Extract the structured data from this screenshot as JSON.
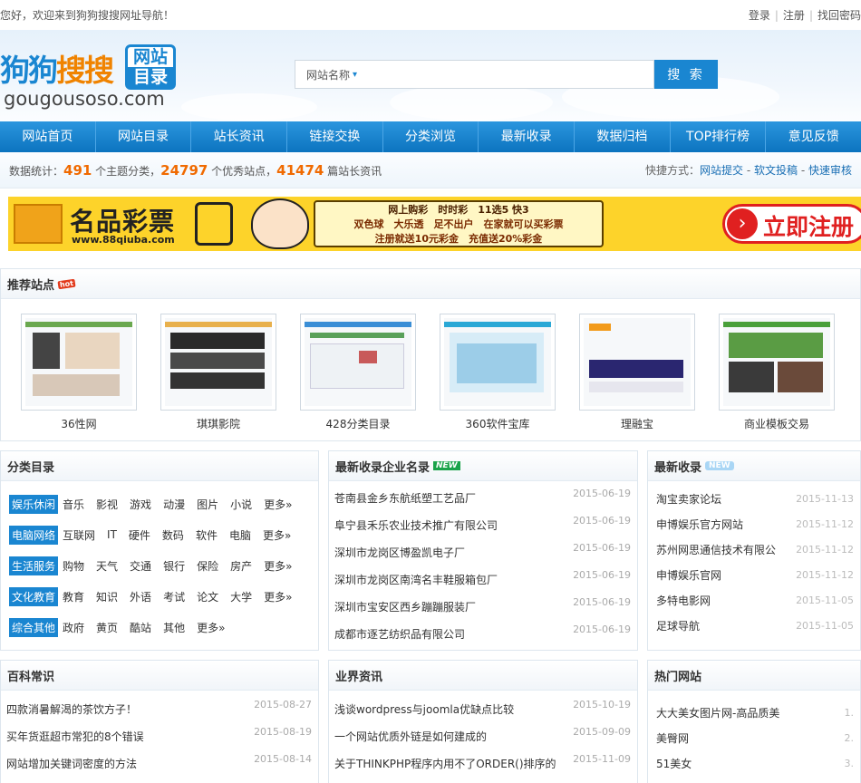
{
  "topbar": {
    "welcome": "您好，欢迎来到狗狗搜搜网址导航！",
    "login": "登录",
    "register": "注册",
    "forgot": "找回密码"
  },
  "logo": {
    "main_a": "狗狗",
    "main_b": "搜搜",
    "box_l1": "网站",
    "box_l2": "目录",
    "domain": "gougousoso.com"
  },
  "search": {
    "select_label": "网站名称",
    "placeholder": "",
    "button": "搜 索"
  },
  "nav": [
    "网站首页",
    "网站目录",
    "站长资讯",
    "链接交换",
    "分类浏览",
    "最新收录",
    "数据归档",
    "TOP排行榜",
    "意见反馈"
  ],
  "stats": {
    "prefix": "数据统计：",
    "cat_count": "491",
    "cat_label": " 个主题分类，",
    "site_count": "24797",
    "site_label": " 个优秀站点，",
    "article_count": "41474",
    "article_label": " 篇站长资讯",
    "quick_label": "快捷方式：",
    "quick_links": [
      "网站提交",
      "软文投稿",
      "快速审核"
    ]
  },
  "banner": {
    "title": "名品彩票",
    "url": "www.88qiuba.com",
    "line1": "网上购彩　时时彩　11选5 快3",
    "line2": "双色球　大乐透　足不出户　在家就可以买彩票",
    "line3": "注册就送10元彩金　充值送20%彩金",
    "register": "立即注册"
  },
  "recommend": {
    "title": "推荐站点",
    "hot": "hot",
    "sites": [
      "36性网",
      "琪琪影院",
      "428分类目录",
      "360软件宝库",
      "理融宝",
      "商业模板交易"
    ]
  },
  "categories": {
    "title": "分类目录",
    "more": "更多»",
    "rows": [
      {
        "tag": "娱乐休闲",
        "links": [
          "音乐",
          "影视",
          "游戏",
          "动漫",
          "图片",
          "小说"
        ]
      },
      {
        "tag": "电脑网络",
        "links": [
          "互联网",
          "IT",
          "硬件",
          "数码",
          "软件",
          "电脑"
        ]
      },
      {
        "tag": "生活服务",
        "links": [
          "购物",
          "天气",
          "交通",
          "银行",
          "保险",
          "房产"
        ]
      },
      {
        "tag": "文化教育",
        "links": [
          "教育",
          "知识",
          "外语",
          "考试",
          "论文",
          "大学"
        ]
      },
      {
        "tag": "综合其他",
        "links": [
          "政府",
          "黄页",
          "酷站",
          "其他"
        ]
      }
    ]
  },
  "companies": {
    "title": "最新收录企业名录",
    "new": "NEW",
    "items": [
      {
        "title": "苍南县金乡东航纸塑工艺品厂",
        "date": "2015-06-19"
      },
      {
        "title": "阜宁县禾乐农业技术推广有限公司",
        "date": "2015-06-19"
      },
      {
        "title": "深圳市龙岗区博盈凯电子厂",
        "date": "2015-06-19"
      },
      {
        "title": "深圳市龙岗区南湾名丰鞋服箱包厂",
        "date": "2015-06-19"
      },
      {
        "title": "深圳市宝安区西乡蹦蹦服装厂",
        "date": "2015-06-19"
      },
      {
        "title": "成都市逐艺纺织品有限公司",
        "date": "2015-06-19"
      }
    ]
  },
  "latest": {
    "title": "最新收录",
    "new": "NEW",
    "items": [
      {
        "title": "淘宝卖家论坛",
        "date": "2015-11-13"
      },
      {
        "title": "申博娱乐官方网站",
        "date": "2015-11-12"
      },
      {
        "title": "苏州网思通信技术有限公",
        "date": "2015-11-12"
      },
      {
        "title": "申博娱乐官网",
        "date": "2015-11-12"
      },
      {
        "title": "多特电影网",
        "date": "2015-11-05"
      },
      {
        "title": "足球导航",
        "date": "2015-11-05"
      }
    ]
  },
  "wiki": {
    "title": "百科常识",
    "items": [
      {
        "title": "四款消暑解渴的茶饮方子！",
        "date": "2015-08-27"
      },
      {
        "title": "买年货逛超市常犯的8个错误",
        "date": "2015-08-19"
      },
      {
        "title": "网站增加关键词密度的方法",
        "date": "2015-08-14"
      }
    ]
  },
  "industry": {
    "title": "业界资讯",
    "items": [
      {
        "title": "浅谈wordpress与joomla优缺点比较",
        "date": "2015-10-19"
      },
      {
        "title": "一个网站优质外链是如何建成的",
        "date": "2015-09-09"
      },
      {
        "title": "关于THINKPHP程序内用不了ORDER()排序的",
        "date": "2015-11-09"
      }
    ]
  },
  "hot_sites": {
    "title": "热门网站",
    "items": [
      {
        "title": "大大美女图片网-高品质美",
        "idx": "1."
      },
      {
        "title": "美臀网",
        "idx": "2."
      },
      {
        "title": "51美女",
        "idx": "3."
      }
    ]
  }
}
